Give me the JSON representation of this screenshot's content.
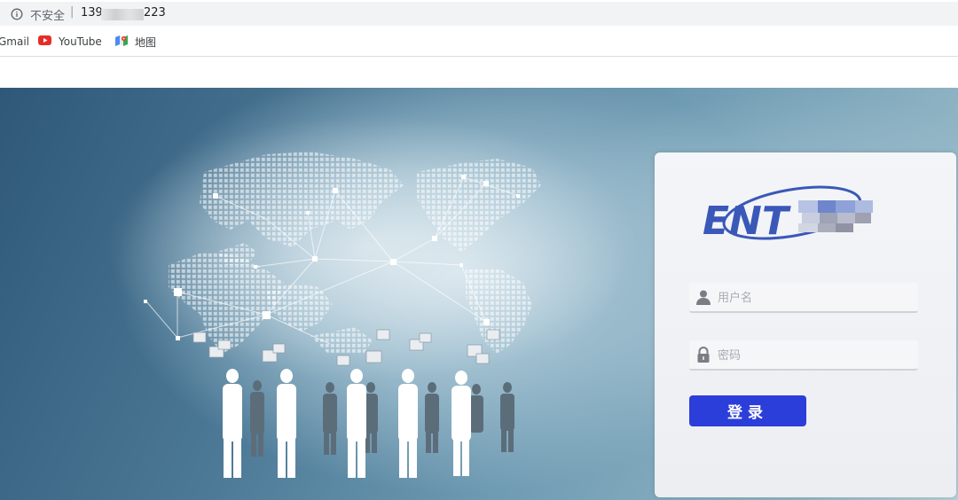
{
  "browser": {
    "security_label": "不安全",
    "separator": "|",
    "url_prefix": "139",
    "url_suffix": "223",
    "icons": {
      "info": "info-circle-icon"
    }
  },
  "bookmarks": [
    {
      "label": "Gmail",
      "icon": "gmail-icon"
    },
    {
      "label": "YouTube",
      "icon": "youtube-icon"
    },
    {
      "label": "地图",
      "icon": "maps-icon"
    }
  ],
  "login": {
    "logo_text": "ENT",
    "username_placeholder": "用户名",
    "password_placeholder": "密码",
    "submit_label": "登录",
    "icons": {
      "username": "user-icon",
      "password": "lock-icon"
    }
  },
  "colors": {
    "login_button": "#2c3ed9",
    "logo_blue": "#3a58b8",
    "hero_dark": "#2f5878",
    "hero_light": "#b6cfd8"
  }
}
